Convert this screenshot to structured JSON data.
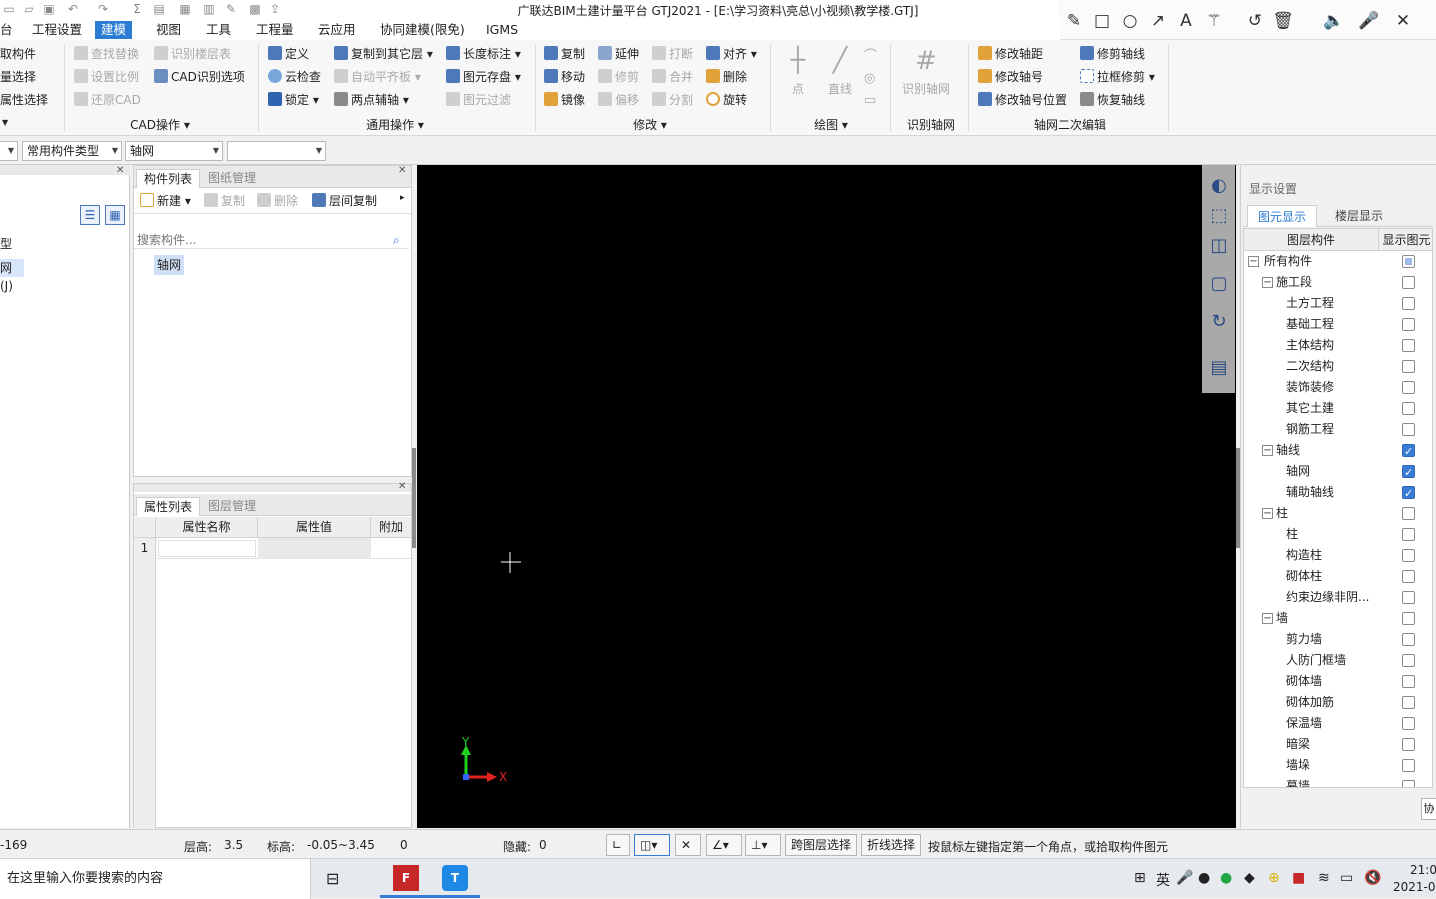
{
  "window": {
    "title": "广联达BIM土建计量平台 GTJ2021 - [E:\\学习资料\\亮总\\小视频\\教学楼.GTJ]"
  },
  "menu": {
    "items": [
      "台",
      "工程设置",
      "建模",
      "视图",
      "工具",
      "工程量",
      "云应用",
      "协同建模(限免)",
      "IGMS"
    ],
    "active": "建模"
  },
  "ribbon": {
    "col1": [
      "取构件",
      "量选择",
      "属性选择"
    ],
    "cad": {
      "items": [
        "查找替换",
        "设置比例",
        "还原CAD",
        "识别楼层表",
        "CAD识别选项"
      ],
      "group": "CAD操作"
    },
    "general": {
      "items": [
        "定义",
        "云检查",
        "锁定",
        "复制到其它层",
        "自动平齐板",
        "两点辅轴",
        "长度标注",
        "图元存盘",
        "图元过滤"
      ],
      "group": "通用操作"
    },
    "modify": {
      "items": [
        "复制",
        "移动",
        "镜像",
        "延伸",
        "修剪",
        "偏移",
        "打断",
        "合并",
        "分割",
        "对齐",
        "删除",
        "旋转"
      ],
      "group": "修改"
    },
    "draw": {
      "items": [
        "点",
        "直线"
      ],
      "group": "绘图"
    },
    "recog": {
      "items": [
        "识别轴网"
      ],
      "group": "识别轴网"
    },
    "axis2": {
      "items": [
        "修改轴距",
        "修改轴号",
        "修改轴号位置",
        "修剪轴线",
        "拉框修剪",
        "恢复轴线"
      ],
      "group": "轴网二次编辑"
    }
  },
  "selectors": {
    "type": "常用构件类型",
    "component": "轴网",
    "extra": ""
  },
  "leftpane": {
    "items": [
      "型",
      "网(J)"
    ]
  },
  "component_panel": {
    "tabs": [
      "构件列表",
      "图纸管理"
    ],
    "toolbar": [
      "新建",
      "复制",
      "删除",
      "层间复制"
    ],
    "search_placeholder": "搜索构件...",
    "items": [
      "轴网"
    ]
  },
  "property_panel": {
    "tabs": [
      "属性列表",
      "图层管理"
    ],
    "columns": [
      "属性名称",
      "属性值",
      "附加"
    ],
    "rows": [
      "1"
    ]
  },
  "canvas": {
    "axis_y": "Y",
    "axis_x": "X"
  },
  "display_settings": {
    "title": "显示设置",
    "tabs": [
      "图元显示",
      "楼层显示"
    ],
    "columns": [
      "图层构件",
      "显示图元"
    ],
    "tree": [
      {
        "label": "所有构件",
        "state": "partial",
        "level": 0,
        "toggle": "−"
      },
      {
        "label": "施工段",
        "state": "off",
        "level": 1,
        "toggle": "−"
      },
      {
        "label": "土方工程",
        "state": "off",
        "level": 2
      },
      {
        "label": "基础工程",
        "state": "off",
        "level": 2
      },
      {
        "label": "主体结构",
        "state": "off",
        "level": 2
      },
      {
        "label": "二次结构",
        "state": "off",
        "level": 2
      },
      {
        "label": "装饰装修",
        "state": "off",
        "level": 2
      },
      {
        "label": "其它土建",
        "state": "off",
        "level": 2
      },
      {
        "label": "钢筋工程",
        "state": "off",
        "level": 2
      },
      {
        "label": "轴线",
        "state": "on",
        "level": 1,
        "toggle": "−"
      },
      {
        "label": "轴网",
        "state": "on",
        "level": 2
      },
      {
        "label": "辅助轴线",
        "state": "on",
        "level": 2
      },
      {
        "label": "柱",
        "state": "off",
        "level": 1,
        "toggle": "−"
      },
      {
        "label": "柱",
        "state": "off",
        "level": 2
      },
      {
        "label": "构造柱",
        "state": "off",
        "level": 2
      },
      {
        "label": "砌体柱",
        "state": "off",
        "level": 2
      },
      {
        "label": "约束边缘非阴...",
        "state": "off",
        "level": 2
      },
      {
        "label": "墙",
        "state": "off",
        "level": 1,
        "toggle": "−"
      },
      {
        "label": "剪力墙",
        "state": "off",
        "level": 2
      },
      {
        "label": "人防门框墙",
        "state": "off",
        "level": 2
      },
      {
        "label": "砌体墙",
        "state": "off",
        "level": 2
      },
      {
        "label": "砌体加筋",
        "state": "off",
        "level": 2
      },
      {
        "label": "保温墙",
        "state": "off",
        "level": 2
      },
      {
        "label": "暗梁",
        "state": "off",
        "level": 2
      },
      {
        "label": "墙垛",
        "state": "off",
        "level": 2
      },
      {
        "label": "幕墙",
        "state": "off",
        "level": 2
      }
    ]
  },
  "statusbar": {
    "coord": "-169",
    "floor_height_label": "层高:",
    "floor_height": "3.5",
    "elevation_label": "标高:",
    "elevation": "-0.05~3.45",
    "value0": "0",
    "hidden_label": "隐藏:",
    "hidden": "0",
    "btn_cross_floor": "跨图层选择",
    "btn_polyline": "折线选择",
    "hint": "按鼠标左键指定第一个角点，或拾取构件图元"
  },
  "taskbar": {
    "search_placeholder": "在这里输入你要搜索的内容",
    "ime": "英",
    "time": "21:0",
    "date": "2021-0"
  }
}
